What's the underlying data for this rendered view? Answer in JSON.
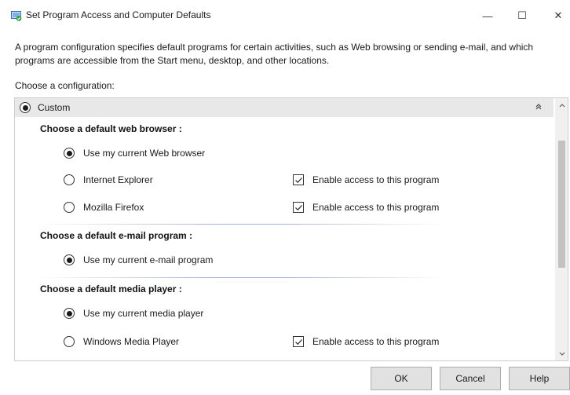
{
  "window": {
    "title": "Set Program Access and Computer Defaults",
    "minimize_glyph": "—",
    "maximize_glyph": "☐",
    "close_glyph": "✕"
  },
  "description": "A program configuration specifies default programs for certain activities, such as Web browsing or sending e-mail, and which programs are accessible from the Start menu, desktop, and other locations.",
  "choose_label": "Choose a configuration:",
  "configuration": {
    "label": "Custom",
    "selected": true,
    "collapse_icon": "collapse-up-icon"
  },
  "sections": {
    "browser": {
      "title": "Choose a default web browser :",
      "options": [
        {
          "label": "Use my current Web browser",
          "selected": true
        },
        {
          "label": "Internet Explorer",
          "selected": false,
          "enable_label": "Enable access to this program",
          "enable_checked": true
        },
        {
          "label": "Mozilla Firefox",
          "selected": false,
          "enable_label": "Enable access to this program",
          "enable_checked": true
        }
      ]
    },
    "email": {
      "title": "Choose a default e-mail program :",
      "options": [
        {
          "label": "Use my current e-mail program",
          "selected": true
        }
      ]
    },
    "media": {
      "title": "Choose a default media player :",
      "options": [
        {
          "label": "Use my current media player",
          "selected": true
        },
        {
          "label": "Windows Media Player",
          "selected": false,
          "enable_label": "Enable access to this program",
          "enable_checked": true
        }
      ]
    }
  },
  "buttons": {
    "ok": "OK",
    "cancel": "Cancel",
    "help": "Help"
  },
  "colors": {
    "header_bg": "#e8e8e8",
    "separator": "#9fb6d6",
    "button_bg": "#e1e1e1"
  }
}
